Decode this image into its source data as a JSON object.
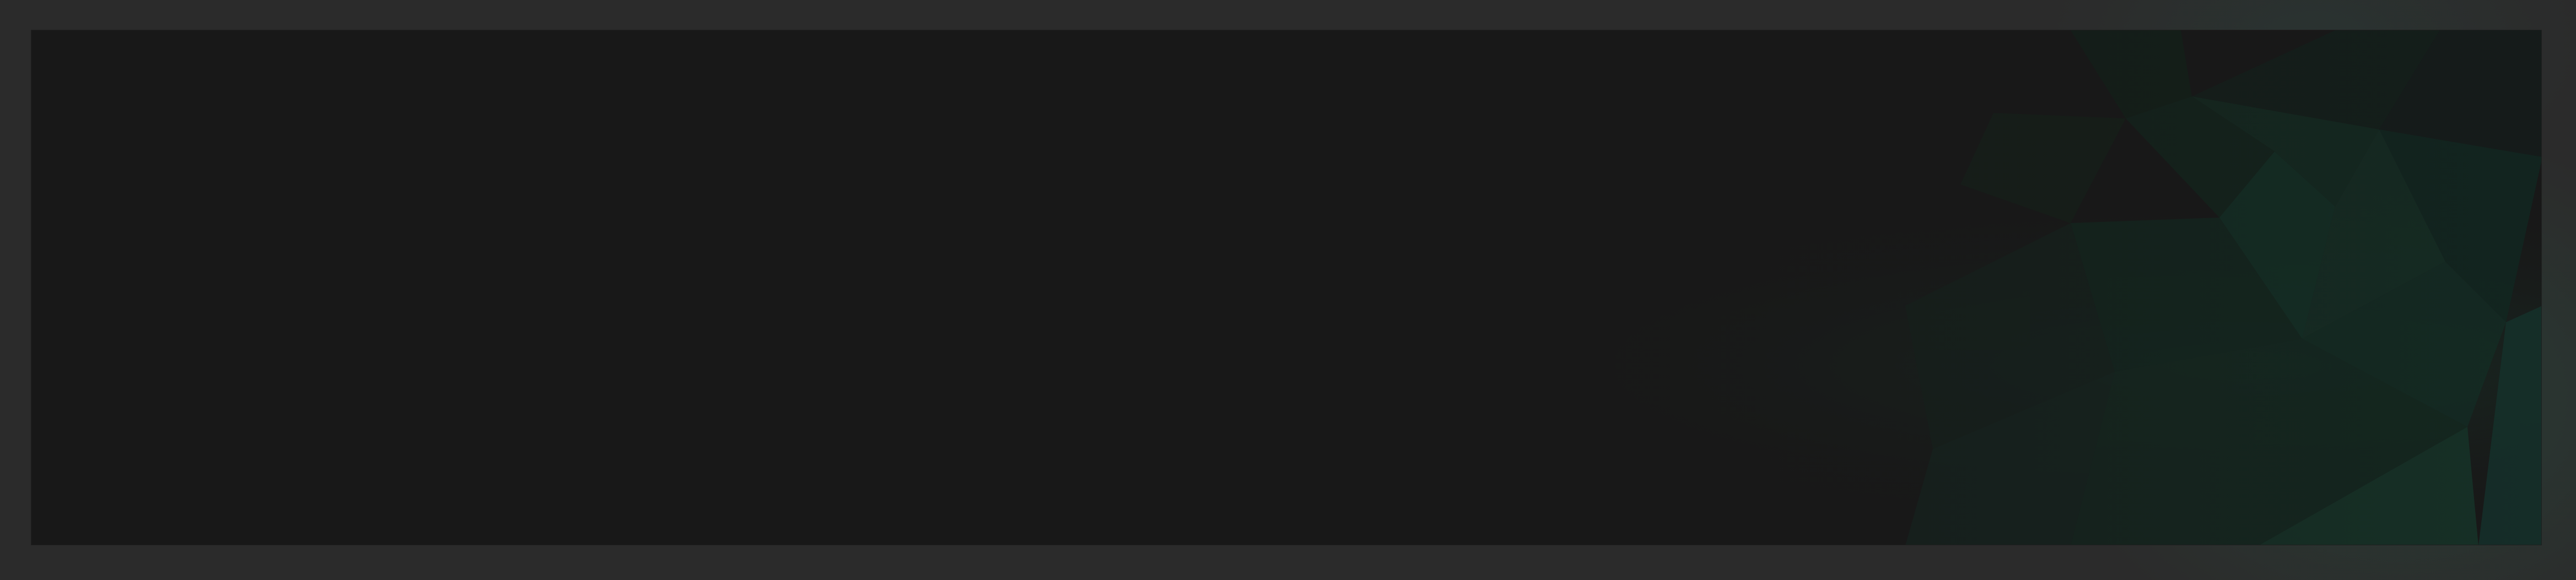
{
  "colors": {
    "frame": "#2b2b2b",
    "panel": "#181818",
    "accent_green": "#13271f",
    "accent_green_light": "#173a2c"
  },
  "panel": {
    "content_text": ""
  }
}
